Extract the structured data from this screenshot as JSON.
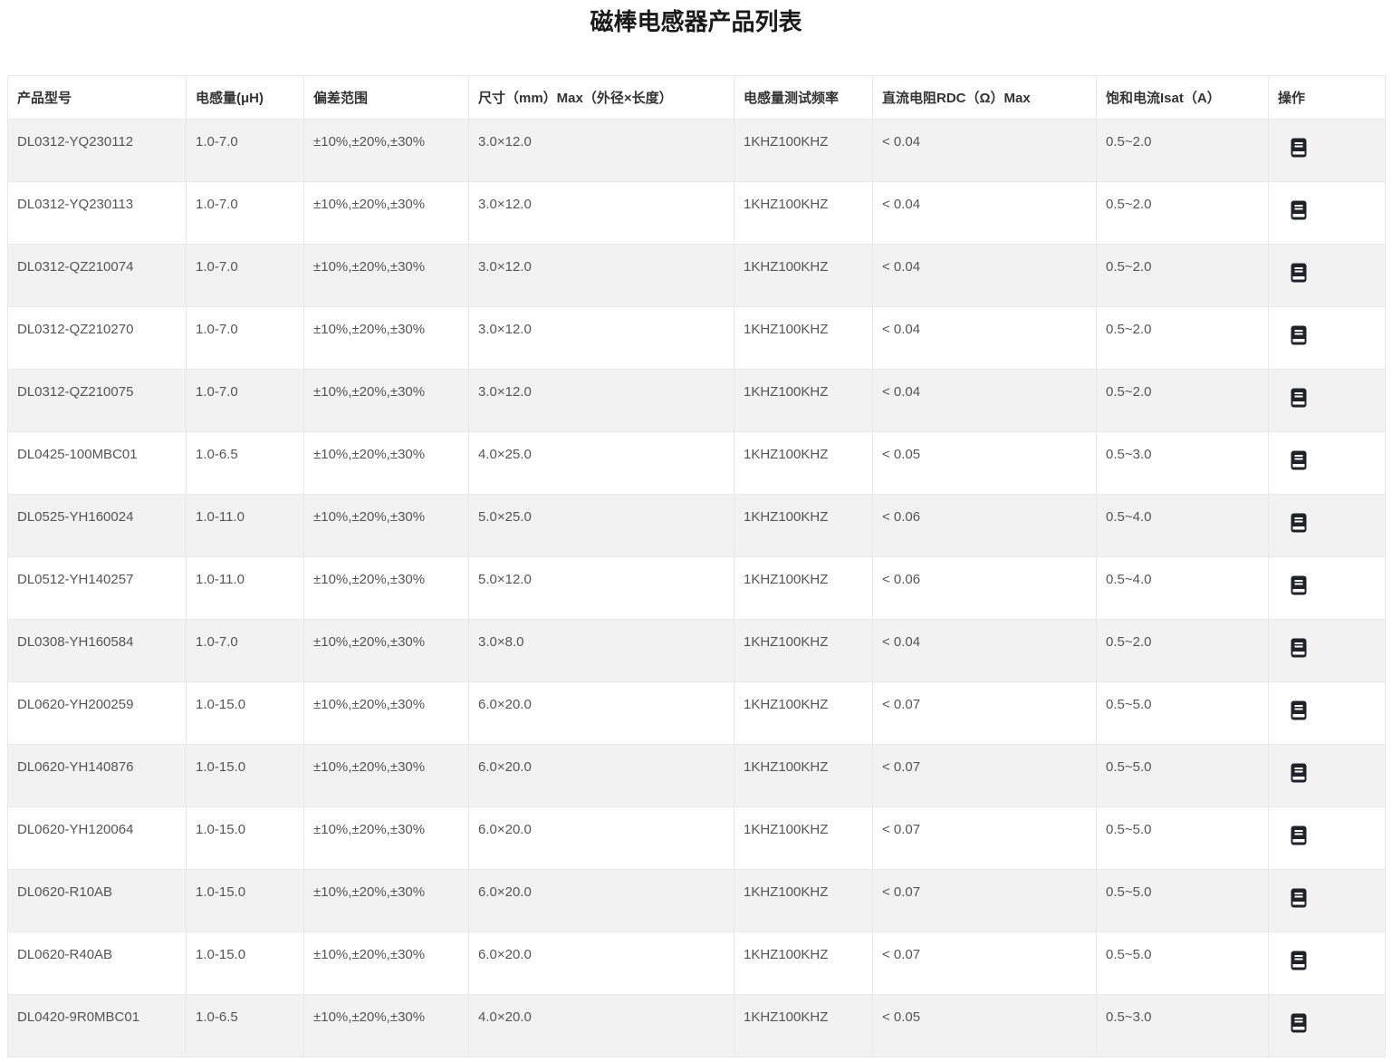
{
  "page": {
    "title": "磁棒电感器产品列表"
  },
  "colors": {
    "stripe_bg": "#f2f2f2",
    "border": "#e8e8e8",
    "header_text": "#333333",
    "cell_text": "#555555",
    "title_text": "#1a1a1a",
    "icon_bg": "#1f2329"
  },
  "table": {
    "columns": [
      {
        "key": "model",
        "label": "产品型号"
      },
      {
        "key": "inductance",
        "label": "电感量(μH)"
      },
      {
        "key": "tolerance",
        "label": "偏差范围"
      },
      {
        "key": "size",
        "label": "尺寸（mm）Max（外径×长度）"
      },
      {
        "key": "frequency",
        "label": "电感量测试频率"
      },
      {
        "key": "rdc",
        "label": "直流电阻RDC（Ω）Max"
      },
      {
        "key": "isat",
        "label": "饱和电流Isat（A）"
      },
      {
        "key": "action",
        "label": "操作"
      }
    ],
    "action_icon": "document-icon",
    "rows": [
      {
        "model": "DL0312-YQ230112",
        "inductance": "1.0-7.0",
        "tolerance": "±10%,±20%,±30%",
        "size": "3.0×12.0",
        "frequency": "1KHZ100KHZ",
        "rdc": "< 0.04",
        "isat": "0.5~2.0"
      },
      {
        "model": "DL0312-YQ230113",
        "inductance": "1.0-7.0",
        "tolerance": "±10%,±20%,±30%",
        "size": "3.0×12.0",
        "frequency": "1KHZ100KHZ",
        "rdc": "< 0.04",
        "isat": "0.5~2.0"
      },
      {
        "model": "DL0312-QZ210074",
        "inductance": "1.0-7.0",
        "tolerance": "±10%,±20%,±30%",
        "size": "3.0×12.0",
        "frequency": "1KHZ100KHZ",
        "rdc": "< 0.04",
        "isat": "0.5~2.0"
      },
      {
        "model": "DL0312-QZ210270",
        "inductance": "1.0-7.0",
        "tolerance": "±10%,±20%,±30%",
        "size": "3.0×12.0",
        "frequency": "1KHZ100KHZ",
        "rdc": "< 0.04",
        "isat": "0.5~2.0"
      },
      {
        "model": "DL0312-QZ210075",
        "inductance": "1.0-7.0",
        "tolerance": "±10%,±20%,±30%",
        "size": "3.0×12.0",
        "frequency": "1KHZ100KHZ",
        "rdc": "< 0.04",
        "isat": "0.5~2.0"
      },
      {
        "model": "DL0425-100MBC01",
        "inductance": "1.0-6.5",
        "tolerance": "±10%,±20%,±30%",
        "size": "4.0×25.0",
        "frequency": "1KHZ100KHZ",
        "rdc": "< 0.05",
        "isat": "0.5~3.0"
      },
      {
        "model": "DL0525-YH160024",
        "inductance": "1.0-11.0",
        "tolerance": "±10%,±20%,±30%",
        "size": "5.0×25.0",
        "frequency": "1KHZ100KHZ",
        "rdc": "< 0.06",
        "isat": "0.5~4.0"
      },
      {
        "model": "DL0512-YH140257",
        "inductance": "1.0-11.0",
        "tolerance": "±10%,±20%,±30%",
        "size": "5.0×12.0",
        "frequency": "1KHZ100KHZ",
        "rdc": "< 0.06",
        "isat": "0.5~4.0"
      },
      {
        "model": "DL0308-YH160584",
        "inductance": "1.0-7.0",
        "tolerance": "±10%,±20%,±30%",
        "size": "3.0×8.0",
        "frequency": "1KHZ100KHZ",
        "rdc": "< 0.04",
        "isat": "0.5~2.0"
      },
      {
        "model": "DL0620-YH200259",
        "inductance": "1.0-15.0",
        "tolerance": "±10%,±20%,±30%",
        "size": "6.0×20.0",
        "frequency": "1KHZ100KHZ",
        "rdc": "< 0.07",
        "isat": "0.5~5.0"
      },
      {
        "model": "DL0620-YH140876",
        "inductance": "1.0-15.0",
        "tolerance": "±10%,±20%,±30%",
        "size": "6.0×20.0",
        "frequency": "1KHZ100KHZ",
        "rdc": "< 0.07",
        "isat": "0.5~5.0"
      },
      {
        "model": "DL0620-YH120064",
        "inductance": "1.0-15.0",
        "tolerance": "±10%,±20%,±30%",
        "size": "6.0×20.0",
        "frequency": "1KHZ100KHZ",
        "rdc": "< 0.07",
        "isat": "0.5~5.0"
      },
      {
        "model": "DL0620-R10AB",
        "inductance": "1.0-15.0",
        "tolerance": "±10%,±20%,±30%",
        "size": "6.0×20.0",
        "frequency": "1KHZ100KHZ",
        "rdc": "< 0.07",
        "isat": "0.5~5.0"
      },
      {
        "model": "DL0620-R40AB",
        "inductance": "1.0-15.0",
        "tolerance": "±10%,±20%,±30%",
        "size": "6.0×20.0",
        "frequency": "1KHZ100KHZ",
        "rdc": "< 0.07",
        "isat": "0.5~5.0"
      },
      {
        "model": "DL0420-9R0MBC01",
        "inductance": "1.0-6.5",
        "tolerance": "±10%,±20%,±30%",
        "size": "4.0×20.0",
        "frequency": "1KHZ100KHZ",
        "rdc": "< 0.05",
        "isat": "0.5~3.0"
      }
    ]
  }
}
